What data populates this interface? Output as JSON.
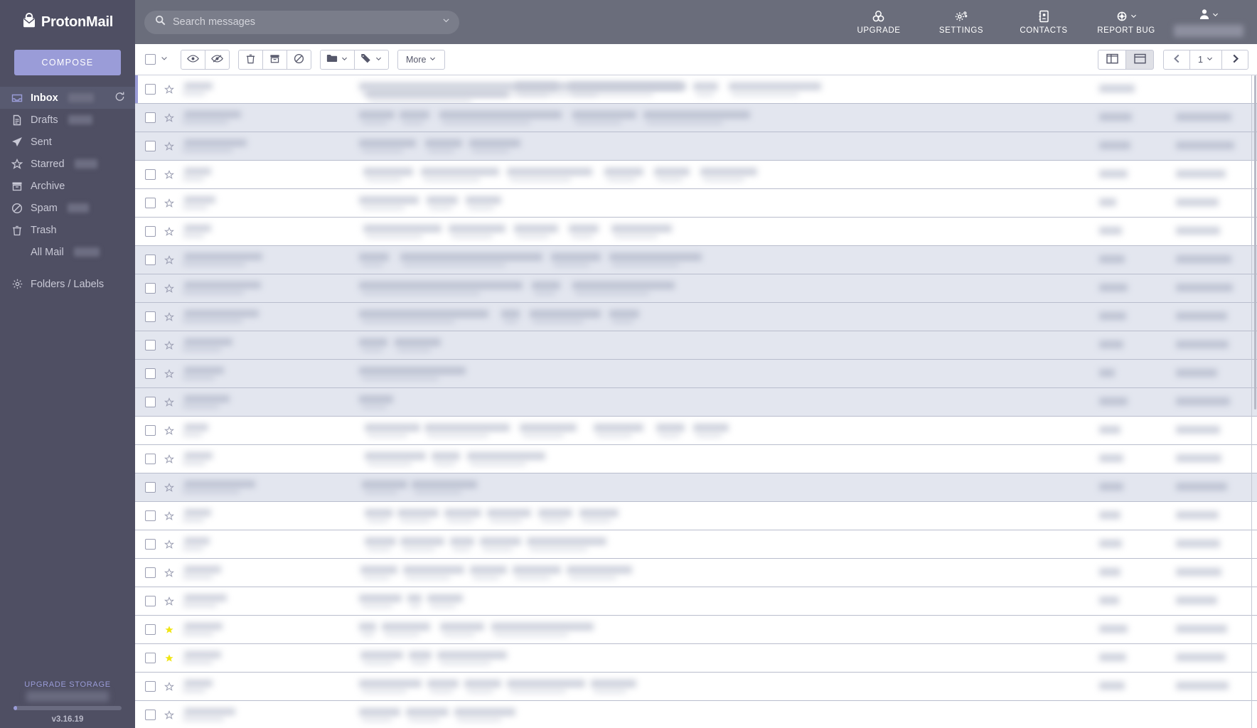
{
  "brand": {
    "name": "ProtonMail",
    "logo_icon": "proton-mail-logo-icon"
  },
  "sidebar": {
    "compose_label": "COMPOSE",
    "items": [
      {
        "label": "Inbox",
        "icon": "inbox-icon",
        "badge": "",
        "active": true,
        "indent": false,
        "has_refresh": true
      },
      {
        "label": "Drafts",
        "icon": "draft-icon",
        "badge": "",
        "active": false,
        "indent": false,
        "has_refresh": false
      },
      {
        "label": "Sent",
        "icon": "sent-icon",
        "badge": null,
        "active": false,
        "indent": false,
        "has_refresh": false
      },
      {
        "label": "Starred",
        "icon": "star-icon",
        "badge": "",
        "active": false,
        "indent": false,
        "has_refresh": false
      },
      {
        "label": "Archive",
        "icon": "archive-icon",
        "badge": null,
        "active": false,
        "indent": false,
        "has_refresh": false
      },
      {
        "label": "Spam",
        "icon": "spam-icon",
        "badge": "",
        "active": false,
        "indent": false,
        "has_refresh": false
      },
      {
        "label": "Trash",
        "icon": "trash-icon",
        "badge": null,
        "active": false,
        "indent": false,
        "has_refresh": false
      },
      {
        "label": "All Mail",
        "icon": null,
        "badge": "",
        "active": false,
        "indent": true,
        "has_refresh": false
      }
    ],
    "folders_labels": {
      "label": "Folders / Labels",
      "icon": "gear-icon"
    },
    "footer": {
      "upgrade_storage_label": "UPGRADE STORAGE",
      "version": "v3.16.19",
      "storage_used_percent": 3
    }
  },
  "topbar": {
    "search": {
      "placeholder": "Search messages",
      "value": "",
      "icon": "search-icon",
      "dropdown_icon": "chevron-down-icon"
    },
    "actions": [
      {
        "label": "UPGRADE",
        "icon": "upgrade-icon",
        "has_caret": false
      },
      {
        "label": "SETTINGS",
        "icon": "gear-icon",
        "has_caret": false
      },
      {
        "label": "CONTACTS",
        "icon": "contacts-icon",
        "has_caret": false
      },
      {
        "label": "REPORT BUG",
        "icon": "report-bug-icon",
        "has_caret": true
      }
    ],
    "user_menu": {
      "icon": "user-icon",
      "caret_icon": "chevron-down-icon",
      "name": ""
    }
  },
  "toolbar": {
    "select_all": {
      "checked": false,
      "caret_icon": "chevron-down-icon"
    },
    "buttons": [
      {
        "name": "mark-as-read",
        "icon": "eye-icon",
        "label": "",
        "caret": false
      },
      {
        "name": "mark-as-unread",
        "icon": "eye-slash-icon",
        "label": "",
        "caret": false
      },
      {
        "name": "delete",
        "icon": "trash-icon",
        "label": "",
        "caret": false
      },
      {
        "name": "archive",
        "icon": "archive-icon",
        "label": "",
        "caret": false
      },
      {
        "name": "spam",
        "icon": "ban-icon",
        "label": "",
        "caret": false
      },
      {
        "name": "move-to-folder",
        "icon": "folder-icon",
        "label": "",
        "caret": true
      },
      {
        "name": "label-as",
        "icon": "tag-icon",
        "label": "",
        "caret": true
      },
      {
        "name": "more",
        "icon": null,
        "label": "More",
        "caret": true
      }
    ],
    "layout": {
      "column_view_icon": "column-layout-icon",
      "row_view_icon": "row-layout-icon",
      "selected": "row"
    },
    "pagination": {
      "prev_icon": "chevron-left-icon",
      "next_icon": "chevron-right-icon",
      "page": "1",
      "page_caret_icon": "chevron-down-icon"
    }
  },
  "message_list": {
    "rows": [
      {
        "unread": false,
        "active": true,
        "starred": false,
        "sender_w": 40,
        "subject": [
          [
            0,
            4,
            460
          ],
          [
            10,
            14,
            200
          ],
          [
            220,
            4,
            60
          ],
          [
            295,
            4,
            160
          ],
          [
            470,
            4,
            35
          ],
          [
            520,
            4,
            130
          ]
        ],
        "size_w": 50,
        "date_w": 0
      },
      {
        "unread": true,
        "active": false,
        "starred": false,
        "sender_w": 80,
        "subject": [
          [
            0,
            4,
            50
          ],
          [
            57,
            4,
            42
          ],
          [
            113,
            4,
            172
          ],
          [
            300,
            4,
            90
          ],
          [
            400,
            4,
            150
          ]
        ],
        "size_w": 46,
        "date_w": 78
      },
      {
        "unread": true,
        "active": false,
        "starred": false,
        "sender_w": 88,
        "subject": [
          [
            0,
            4,
            80
          ],
          [
            93,
            4,
            52
          ],
          [
            155,
            4,
            72
          ]
        ],
        "size_w": 44,
        "date_w": 82
      },
      {
        "unread": false,
        "active": false,
        "starred": false,
        "sender_w": 38,
        "subject": [
          [
            6,
            4,
            70
          ],
          [
            87,
            4,
            110
          ],
          [
            208,
            4,
            120
          ],
          [
            345,
            4,
            55
          ],
          [
            415,
            4,
            50
          ],
          [
            480,
            4,
            80
          ]
        ],
        "size_w": 40,
        "date_w": 70
      },
      {
        "unread": false,
        "active": false,
        "starred": false,
        "sender_w": 44,
        "subject": [
          [
            0,
            4,
            84
          ],
          [
            95,
            4,
            44
          ],
          [
            150,
            4,
            50
          ]
        ],
        "size_w": 24,
        "date_w": 60
      },
      {
        "unread": false,
        "active": false,
        "starred": false,
        "sender_w": 38,
        "subject": [
          [
            6,
            4,
            110
          ],
          [
            126,
            4,
            80
          ],
          [
            218,
            4,
            62
          ],
          [
            295,
            4,
            42
          ],
          [
            355,
            4,
            85
          ]
        ],
        "size_w": 32,
        "date_w": 62
      },
      {
        "unread": true,
        "active": false,
        "starred": false,
        "sender_w": 110,
        "subject": [
          [
            0,
            4,
            42
          ],
          [
            58,
            4,
            200
          ],
          [
            270,
            4,
            70
          ],
          [
            352,
            4,
            130
          ]
        ],
        "size_w": 36,
        "date_w": 78
      },
      {
        "unread": true,
        "active": false,
        "starred": false,
        "sender_w": 108,
        "subject": [
          [
            0,
            4,
            230
          ],
          [
            243,
            4,
            40
          ],
          [
            300,
            4,
            144
          ]
        ],
        "size_w": 40,
        "date_w": 80
      },
      {
        "unread": true,
        "active": false,
        "starred": false,
        "sender_w": 105,
        "subject": [
          [
            0,
            4,
            182
          ],
          [
            200,
            4,
            26
          ],
          [
            240,
            4,
            100
          ],
          [
            352,
            4,
            42
          ]
        ],
        "size_w": 38,
        "date_w": 72
      },
      {
        "unread": true,
        "active": false,
        "starred": false,
        "sender_w": 68,
        "subject": [
          [
            0,
            4,
            40
          ],
          [
            50,
            4,
            65
          ]
        ],
        "size_w": 34,
        "date_w": 74
      },
      {
        "unread": true,
        "active": false,
        "starred": false,
        "sender_w": 56,
        "subject": [
          [
            0,
            4,
            150
          ]
        ],
        "size_w": 22,
        "date_w": 58
      },
      {
        "unread": true,
        "active": false,
        "starred": false,
        "sender_w": 64,
        "subject": [
          [
            0,
            4,
            48
          ]
        ],
        "size_w": 40,
        "date_w": 76
      },
      {
        "unread": false,
        "active": false,
        "starred": false,
        "sender_w": 34,
        "subject": [
          [
            8,
            4,
            78
          ],
          [
            92,
            4,
            120
          ],
          [
            226,
            4,
            80
          ],
          [
            330,
            4,
            70
          ],
          [
            418,
            4,
            40
          ],
          [
            470,
            4,
            50
          ]
        ],
        "size_w": 30,
        "date_w": 62
      },
      {
        "unread": false,
        "active": false,
        "starred": false,
        "sender_w": 40,
        "subject": [
          [
            8,
            4,
            86
          ],
          [
            102,
            4,
            40
          ],
          [
            152,
            4,
            110
          ]
        ],
        "size_w": 34,
        "date_w": 64
      },
      {
        "unread": true,
        "active": false,
        "starred": false,
        "sender_w": 100,
        "subject": [
          [
            4,
            4,
            64
          ],
          [
            74,
            4,
            92
          ]
        ],
        "size_w": 34,
        "date_w": 72
      },
      {
        "unread": false,
        "active": false,
        "starred": false,
        "sender_w": 38,
        "subject": [
          [
            8,
            4,
            40
          ],
          [
            54,
            4,
            58
          ],
          [
            120,
            4,
            52
          ],
          [
            180,
            4,
            62
          ],
          [
            252,
            4,
            48
          ],
          [
            310,
            4,
            55
          ]
        ],
        "size_w": 30,
        "date_w": 60
      },
      {
        "unread": false,
        "active": false,
        "starred": false,
        "sender_w": 36,
        "subject": [
          [
            8,
            4,
            44
          ],
          [
            58,
            4,
            62
          ],
          [
            128,
            4,
            34
          ],
          [
            170,
            4,
            58
          ],
          [
            236,
            4,
            112
          ]
        ],
        "size_w": 32,
        "date_w": 62
      },
      {
        "unread": false,
        "active": false,
        "starred": false,
        "sender_w": 52,
        "subject": [
          [
            2,
            4,
            52
          ],
          [
            62,
            4,
            86
          ],
          [
            156,
            4,
            52
          ],
          [
            216,
            4,
            68
          ],
          [
            292,
            4,
            92
          ]
        ],
        "size_w": 30,
        "date_w": 64
      },
      {
        "unread": false,
        "active": false,
        "starred": false,
        "sender_w": 60,
        "subject": [
          [
            0,
            4,
            60
          ],
          [
            68,
            4,
            20
          ],
          [
            96,
            4,
            50
          ]
        ],
        "size_w": 28,
        "date_w": 58
      },
      {
        "unread": false,
        "active": false,
        "starred": true,
        "sender_w": 54,
        "subject": [
          [
            0,
            4,
            24
          ],
          [
            32,
            4,
            68
          ],
          [
            114,
            4,
            62
          ],
          [
            186,
            4,
            144
          ]
        ],
        "size_w": 40,
        "date_w": 72
      },
      {
        "unread": false,
        "active": false,
        "starred": true,
        "sender_w": 52,
        "subject": [
          [
            2,
            4,
            60
          ],
          [
            70,
            4,
            32
          ],
          [
            110,
            4,
            98
          ]
        ],
        "size_w": 38,
        "date_w": 70
      },
      {
        "unread": false,
        "active": false,
        "starred": false,
        "sender_w": 40,
        "subject": [
          [
            0,
            4,
            88
          ],
          [
            96,
            4,
            44
          ],
          [
            148,
            4,
            52
          ],
          [
            208,
            4,
            110
          ],
          [
            326,
            4,
            64
          ]
        ],
        "size_w": 36,
        "date_w": 74
      },
      {
        "unread": false,
        "active": false,
        "starred": false,
        "sender_w": 72,
        "subject": [
          [
            0,
            4,
            58
          ],
          [
            66,
            4,
            60
          ],
          [
            134,
            4,
            86
          ]
        ],
        "size_w": 0,
        "date_w": 0
      }
    ]
  }
}
